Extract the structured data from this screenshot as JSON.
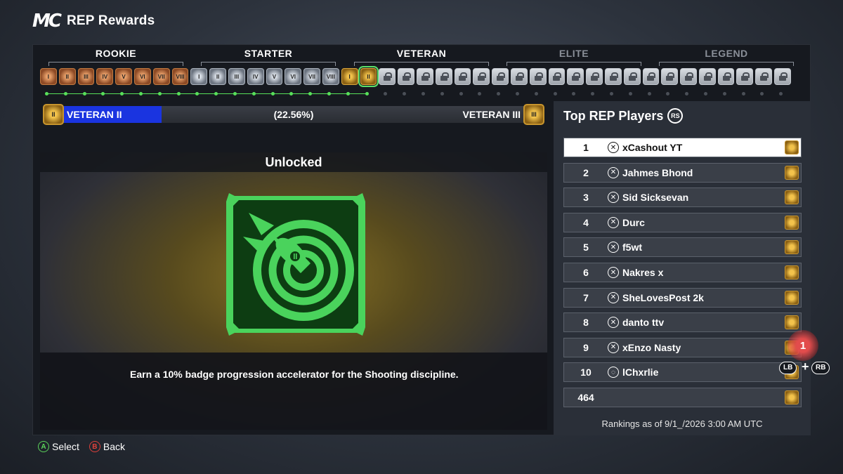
{
  "header": {
    "logo": "MC",
    "title": "REP Rewards"
  },
  "tiers": [
    {
      "name": "ROOKIE",
      "locked": false
    },
    {
      "name": "STARTER",
      "locked": false
    },
    {
      "name": "VETERAN",
      "locked": false
    },
    {
      "name": "ELITE",
      "locked": true
    },
    {
      "name": "LEGEND",
      "locked": true
    }
  ],
  "badge_levels": [
    "I",
    "II",
    "III",
    "IV",
    "V",
    "VI",
    "VII",
    "VIII"
  ],
  "unlocked_count": 18,
  "current_index": 17,
  "progress": {
    "current_label": "VETERAN II",
    "current_roman": "II",
    "percent_text": "(22.56%)",
    "percent": 22.56,
    "next_label": "VETERAN III",
    "next_roman": "III"
  },
  "reward": {
    "status": "Unlocked",
    "icon": "shooting-rocket-target-icon",
    "description": "Earn a 10% badge progression accelerator for the Shooting discipline."
  },
  "leaderboard": {
    "title": "Top REP Players",
    "title_button": "RS",
    "rows": [
      {
        "rank": "1",
        "name": "xCashout YT",
        "platform": "xbox"
      },
      {
        "rank": "2",
        "name": "Jahmes Bhond",
        "platform": "xbox"
      },
      {
        "rank": "3",
        "name": "Sid Sicksevan",
        "platform": "xbox"
      },
      {
        "rank": "4",
        "name": "Durc",
        "platform": "xbox"
      },
      {
        "rank": "5",
        "name": "f5wt",
        "platform": "xbox"
      },
      {
        "rank": "6",
        "name": "Nakres x",
        "platform": "xbox"
      },
      {
        "rank": "7",
        "name": "SheLovesPost 2k",
        "platform": "xbox"
      },
      {
        "rank": "8",
        "name": "danto ttv",
        "platform": "xbox"
      },
      {
        "rank": "9",
        "name": "xEnzo Nasty",
        "platform": "xbox"
      },
      {
        "rank": "10",
        "name": "lChxrlie",
        "platform": "playstation"
      },
      {
        "rank": "464",
        "name": "",
        "platform": ""
      }
    ],
    "as_of": "Rankings as of 9/1_/2026 3:00 AM UTC"
  },
  "rank_button": "1",
  "shoulder": {
    "lb": "LB",
    "plus": "+",
    "rb": "RB"
  },
  "footer": {
    "select_key": "A",
    "select_label": "Select",
    "back_key": "B",
    "back_label": "Back"
  }
}
